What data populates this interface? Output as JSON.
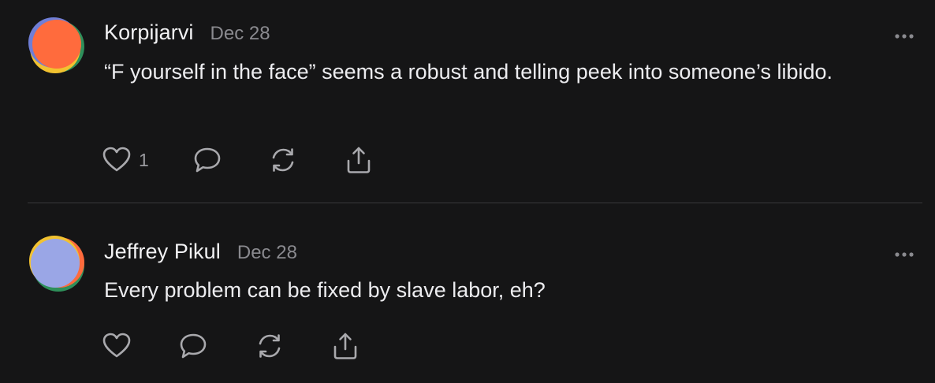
{
  "comments": [
    {
      "author": "Korpijarvi",
      "date": "Dec 28",
      "text": "“F yourself in the face” seems a robust and telling peek into someone’s libido.",
      "like_count": "1",
      "avatar_colors": [
        "#ff6b3d",
        "#2e8f5a",
        "#f2c230",
        "#6f7ed6"
      ]
    },
    {
      "author": "Jeffrey Pikul",
      "date": "Dec 28",
      "text": "Every problem can be fixed by slave labor, eh?",
      "like_count": "",
      "avatar_colors": [
        "#9aa6e6",
        "#2e8f5a",
        "#ff6b3d",
        "#f2c230"
      ]
    }
  ],
  "icons": {
    "like": "heart-icon",
    "reply": "speech-bubble-icon",
    "restack": "refresh-icon",
    "share": "share-icon",
    "more": "ellipsis-icon"
  },
  "colors": {
    "background": "#151516",
    "text": "#ececef",
    "muted": "#8a8a8f",
    "icon": "#a9a9ad",
    "divider": "#38383b"
  }
}
